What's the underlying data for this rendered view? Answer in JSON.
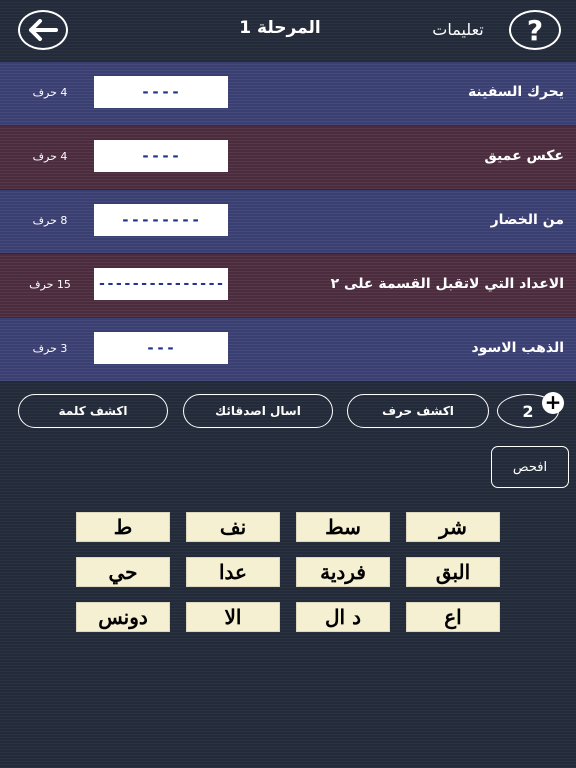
{
  "header": {
    "back_icon": "arrow-left-icon",
    "level_title": "المرحلة 1",
    "instructions_label": "تعليمات",
    "help_label": "?"
  },
  "clues": [
    {
      "text": "يحرك السفينة",
      "dashes": "----",
      "count": "4 حرف",
      "color": "#3a3f72"
    },
    {
      "text": "عكس عميق",
      "dashes": "----",
      "count": "4 حرف",
      "color": "#4b2c3e"
    },
    {
      "text": "من الخضار",
      "dashes": "--------",
      "count": "8 حرف",
      "color": "#3a3f72"
    },
    {
      "text": "الاعداد التي لاتقبل القسمة على ٢",
      "dashes": "---------------",
      "count": "15 حرف",
      "color": "#4b2c3e"
    },
    {
      "text": "الذهب الاسود",
      "dashes": "---",
      "count": "3 حرف",
      "color": "#3a3f72"
    }
  ],
  "actions": {
    "reveal_word": "اكشف كلمة",
    "ask_friends": "اسال اصدقائك",
    "reveal_letter": "اكشف حرف",
    "hint_count": "2",
    "plus": "+"
  },
  "check_label": "افحص",
  "tiles": [
    [
      "شر",
      "سط",
      "نف",
      "ط"
    ],
    [
      "البق",
      "فردية",
      "عدا",
      "حي"
    ],
    [
      "اع",
      "د ال",
      "الا",
      "دونس"
    ]
  ]
}
